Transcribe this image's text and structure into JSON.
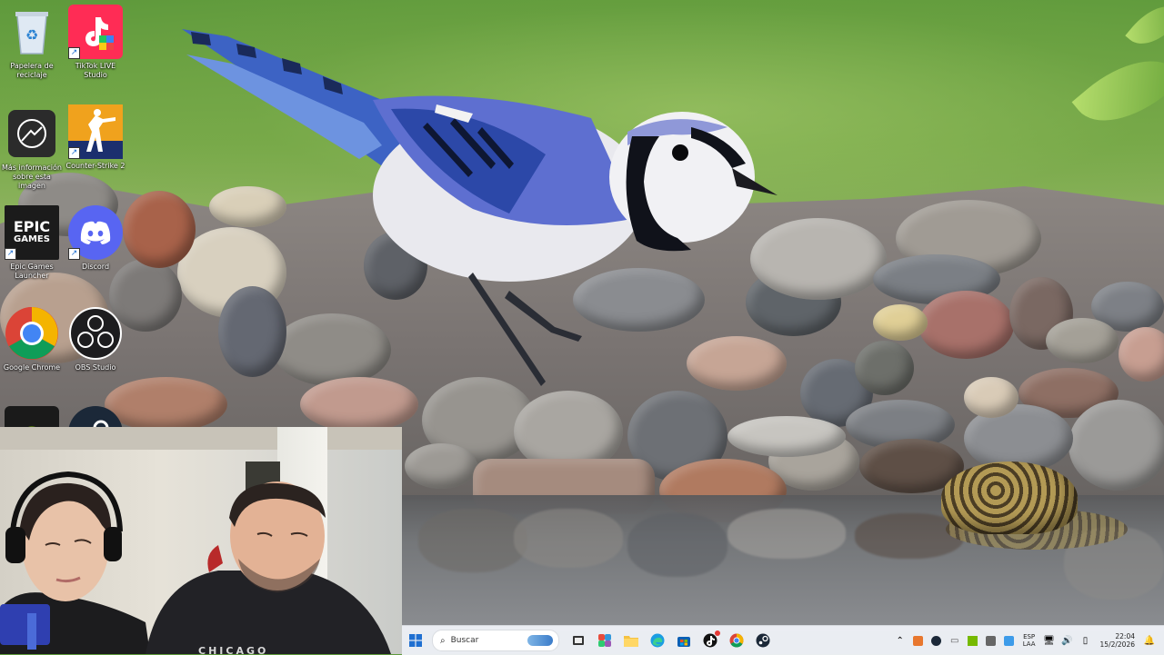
{
  "desktop": {
    "icons": [
      {
        "id": "recycle-bin",
        "label": "Papelera de reciclaje"
      },
      {
        "id": "tiktok-live-studio",
        "label": "TikTok LIVE Studio"
      },
      {
        "id": "more-info-image",
        "label": "Más información sobre esta imagen"
      },
      {
        "id": "counter-strike-2",
        "label": "Counter-Strike 2"
      },
      {
        "id": "epic-games-launcher",
        "label": "Epic Games Launcher",
        "tile_text_top": "EPIC",
        "tile_text_bottom": "GAMES"
      },
      {
        "id": "discord",
        "label": "Discord"
      },
      {
        "id": "google-chrome",
        "label": "Google Chrome"
      },
      {
        "id": "obs-studio",
        "label": "OBS Studio"
      }
    ]
  },
  "webcam": {
    "shirt_text": "CHICAGO"
  },
  "taskbar": {
    "search_placeholder": "Buscar",
    "pinned": [
      "start-icon",
      "search-icon",
      "task-view-icon",
      "store-icon",
      "file-explorer-icon",
      "edge-icon",
      "microsoft-store-icon",
      "app-with-notification-icon",
      "chrome-icon",
      "steam-icon"
    ],
    "tray": {
      "language_top": "ESP",
      "language_bottom": "LAA",
      "time": "22:04",
      "date": "15/2/2026"
    }
  },
  "colors": {
    "taskbar_bg": "#eef1f6",
    "accent_blue": "#1f6fd1"
  }
}
